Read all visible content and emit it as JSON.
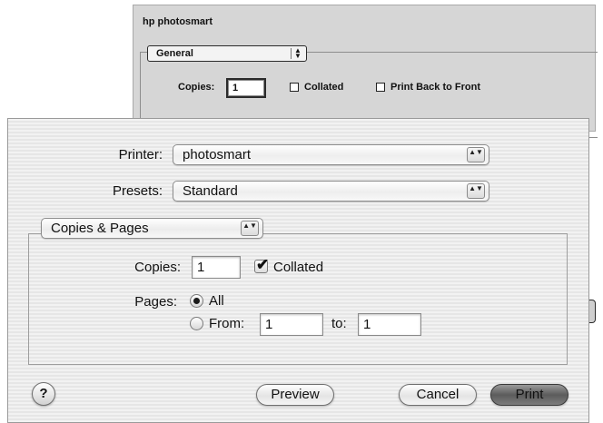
{
  "back_dialog": {
    "title": "hp photosmart",
    "panel_popup": "General",
    "copies_label": "Copies:",
    "copies_value": "1",
    "collated_label": "Collated",
    "print_back_to_front_label": "Print Back to Front"
  },
  "dialog": {
    "printer_label": "Printer:",
    "printer_value": "photosmart",
    "presets_label": "Presets:",
    "presets_value": "Standard",
    "panel_popup": "Copies & Pages",
    "copies_label": "Copies:",
    "copies_value": "1",
    "collated_label": "Collated",
    "collated_checked": true,
    "pages_label": "Pages:",
    "all_label": "All",
    "all_selected": true,
    "from_label": "From:",
    "from_value": "1",
    "to_label": "to:",
    "to_value": "1",
    "help_glyph": "?",
    "preview_label": "Preview",
    "cancel_label": "Cancel",
    "print_label": "Print",
    "stepper_glyph": "▲▼",
    "check_glyph": "✔"
  }
}
